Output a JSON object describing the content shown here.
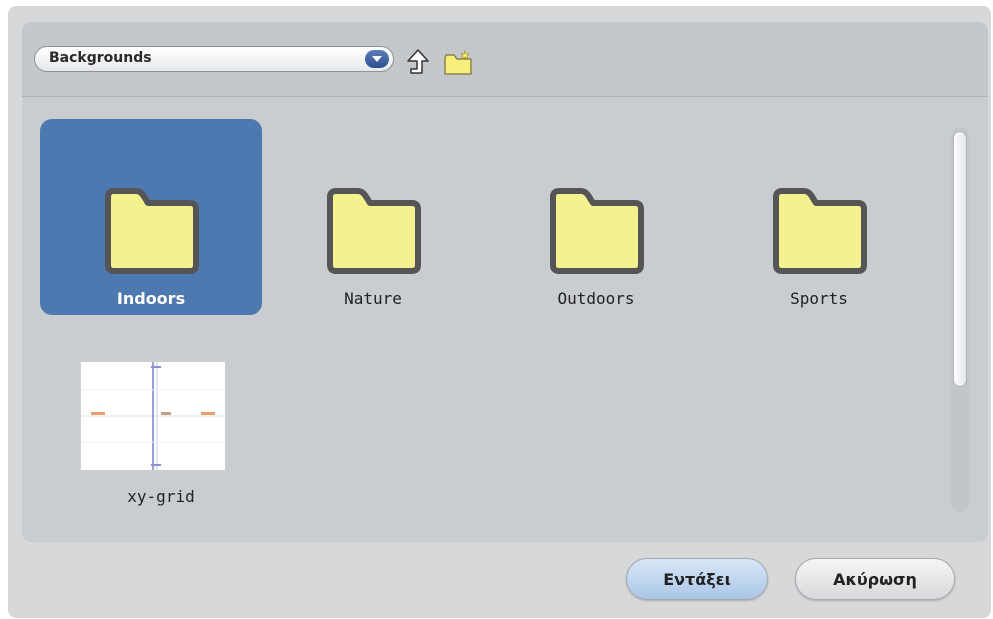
{
  "toolbar": {
    "dropdown_value": "Backgrounds",
    "up_icon": "up-arrow-icon",
    "new_folder_icon": "new-folder-icon"
  },
  "items": [
    {
      "label": "Indoors",
      "type": "folder",
      "selected": true
    },
    {
      "label": "Nature",
      "type": "folder",
      "selected": false
    },
    {
      "label": "Outdoors",
      "type": "folder",
      "selected": false
    },
    {
      "label": "Sports",
      "type": "folder",
      "selected": false
    },
    {
      "label": "xy-grid",
      "type": "image",
      "selected": false
    }
  ],
  "buttons": {
    "ok_label": "Εντάξει",
    "cancel_label": "Ακύρωση"
  },
  "colors": {
    "selection": "#4d78b0",
    "folder_fill": "#f6f18f",
    "folder_stroke": "#555555"
  }
}
